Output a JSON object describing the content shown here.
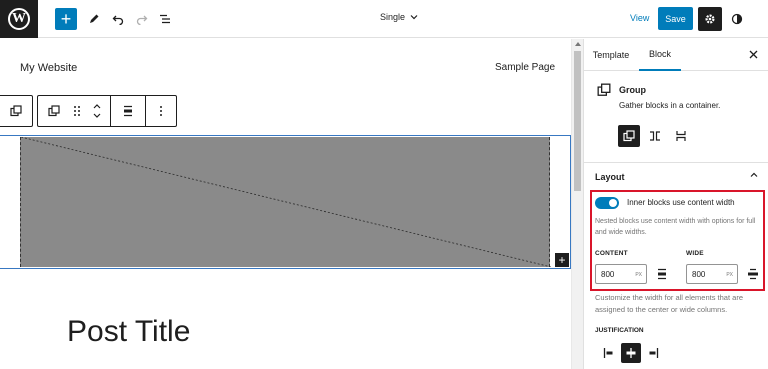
{
  "topbar": {
    "document_title": "Single",
    "view_label": "View",
    "save_label": "Save"
  },
  "canvas": {
    "site_title": "My Website",
    "nav_item": "Sample Page",
    "post_title": "Post Title"
  },
  "sidebar": {
    "tabs": [
      {
        "label": "Template",
        "active": false
      },
      {
        "label": "Block",
        "active": true
      }
    ],
    "block": {
      "name": "Group",
      "description": "Gather blocks in a container."
    },
    "layout": {
      "header": "Layout",
      "toggle_label": "Inner blocks use content width",
      "toggle_on": true,
      "help": "Nested blocks use content width with options for full and wide widths.",
      "content_label": "CONTENT",
      "content_value": "800",
      "wide_label": "WIDE",
      "wide_value": "800",
      "unit": "PX",
      "width_help": "Customize the width for all elements that are assigned to the center or wide columns.",
      "justification_label": "JUSTIFICATION"
    }
  },
  "colors": {
    "accent": "#007cba",
    "highlight": "#d9152a",
    "dark": "#1e1e1e"
  }
}
